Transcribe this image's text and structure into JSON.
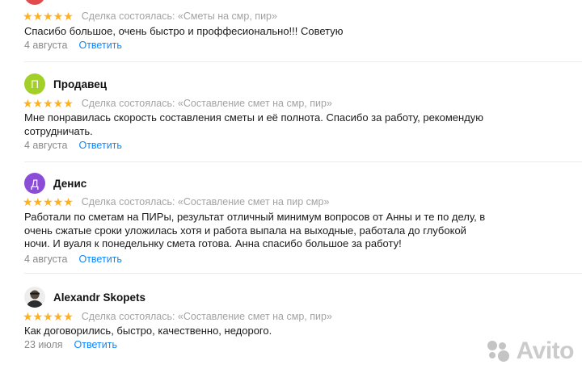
{
  "reviews": [
    {
      "author": "",
      "avatar_letter": "",
      "avatar_color": "#e24b4b",
      "stars": "★★★★★",
      "deal": "Сделка состоялась: «Сметы на смр, пир»",
      "text": "Спасибо большое, очень быстро и проффесионально!!! Советую",
      "date": "4 августа",
      "reply": "Ответить"
    },
    {
      "author": "Продавец",
      "avatar_letter": "П",
      "avatar_color": "#a3cf29",
      "stars": "★★★★★",
      "deal": "Сделка состоялась: «Составление смет на смр, пир»",
      "text": "Мне понравилась скорость составления сметы и её полнота. Спасибо за работу, рекомендую сотрудничать.",
      "date": "4 августа",
      "reply": "Ответить"
    },
    {
      "author": "Денис",
      "avatar_letter": "Д",
      "avatar_color": "#8b4cd8",
      "stars": "★★★★★",
      "deal": "Сделка состоялась: «Составление смет на пир смр»",
      "text": "Работали по сметам на ПИРы, результат отличный минимум вопросов от Анны и те по делу, в очень сжатые сроки уложилась хотя и работа выпала на выходные, работала до глубокой ночи. И вуаля к понедельнку смета готова. Анна спасибо большое за работу!",
      "date": "4 августа",
      "reply": "Ответить"
    },
    {
      "author": "Alexandr Skopets",
      "avatar_letter": "",
      "avatar_color": "#4a4a4a",
      "stars": "★★★★★",
      "deal": "Сделка состоялась: «Составление смет на смр, пир»",
      "text": "Как договорились, быстро, качественно, недорого.",
      "date": "23 июля",
      "reply": "Ответить"
    }
  ],
  "watermark": "Avito",
  "colors": {
    "star": "#ffb021",
    "link": "#0a88ff",
    "muted": "#a3a3a3"
  }
}
